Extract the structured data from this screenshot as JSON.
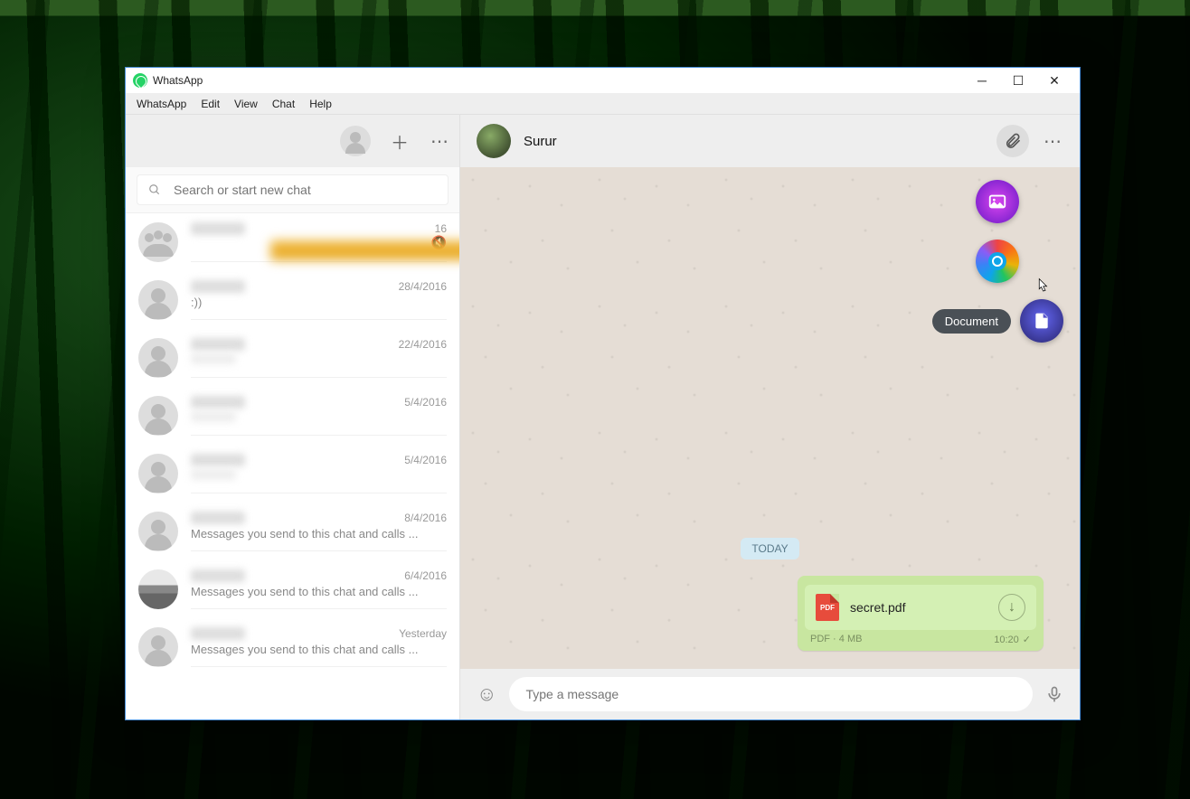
{
  "titlebar": {
    "app_name": "WhatsApp"
  },
  "menubar": {
    "items": [
      "WhatsApp",
      "Edit",
      "View",
      "Chat",
      "Help"
    ]
  },
  "search": {
    "placeholder": "Search or start new chat"
  },
  "chats": [
    {
      "date": "16",
      "msg": "",
      "avatar": "group",
      "muted": true
    },
    {
      "date": "28/4/2016",
      "msg": ":))",
      "avatar": "generic"
    },
    {
      "date": "22/4/2016",
      "msg": "",
      "avatar": "generic",
      "blurmsg": true
    },
    {
      "date": "5/4/2016",
      "msg": "",
      "avatar": "generic",
      "blurmsg": true
    },
    {
      "date": "5/4/2016",
      "msg": "",
      "avatar": "generic",
      "blurmsg": true
    },
    {
      "date": "8/4/2016",
      "msg": "Messages you send to this chat and calls ...",
      "avatar": "generic"
    },
    {
      "date": "6/4/2016",
      "msg": "Messages you send to this chat and calls ...",
      "avatar": "img1"
    },
    {
      "date": "Yesterday",
      "msg": "Messages you send to this chat and calls ...",
      "avatar": "generic"
    }
  ],
  "conversation": {
    "contact_name": "Surur",
    "date_label": "TODAY",
    "message": {
      "filename": "secret.pdf",
      "type_label": "PDF",
      "size_label": "4 MB",
      "time": "10:20",
      "pdf_badge": "PDF"
    }
  },
  "attach": {
    "tooltip_document": "Document"
  },
  "compose": {
    "placeholder": "Type a message"
  }
}
